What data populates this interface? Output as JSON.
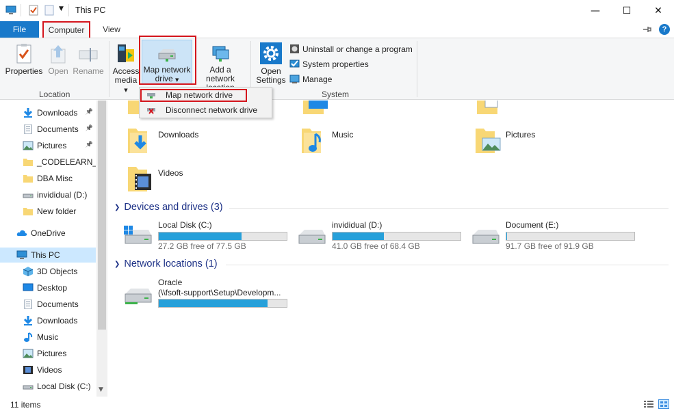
{
  "window": {
    "title": "This PC",
    "minimize": "—",
    "maximize": "☐",
    "close": "✕"
  },
  "ribbon_tabs": {
    "file": "File",
    "computer": "Computer",
    "view": "View"
  },
  "ribbon": {
    "location": {
      "label": "Location",
      "properties": "Properties",
      "open": "Open",
      "rename": "Rename"
    },
    "network": {
      "access_media_1": "Access",
      "access_media_2": "media",
      "map_drive_1": "Map network",
      "map_drive_2": "drive",
      "add_location_1": "Add a network",
      "add_location_2": "location"
    },
    "system": {
      "label": "System",
      "open_settings_1": "Open",
      "open_settings_2": "Settings",
      "uninstall": "Uninstall or change a program",
      "system_properties": "System properties",
      "manage": "Manage"
    }
  },
  "dropdown": {
    "map_network_drive": "Map network drive",
    "disconnect_network_drive": "Disconnect network drive"
  },
  "nav": {
    "items": [
      {
        "label": "Downloads",
        "icon": "download-icon",
        "pinned": true
      },
      {
        "label": "Documents",
        "icon": "document-icon",
        "pinned": true
      },
      {
        "label": "Pictures",
        "icon": "picture-icon",
        "pinned": true
      },
      {
        "label": "_CODELEARN_-_",
        "icon": "folder-icon",
        "pinned": false
      },
      {
        "label": "DBA Misc",
        "icon": "folder-icon",
        "pinned": false
      },
      {
        "label": "invididual (D:)",
        "icon": "drive-icon",
        "pinned": false
      },
      {
        "label": "New folder",
        "icon": "folder-icon",
        "pinned": false
      },
      {
        "label": "OneDrive",
        "icon": "cloud-icon",
        "pinned": false
      },
      {
        "label": "This PC",
        "icon": "computer-icon",
        "pinned": false
      },
      {
        "label": "3D Objects",
        "icon": "cube-icon",
        "pinned": false
      },
      {
        "label": "Desktop",
        "icon": "desktop-icon",
        "pinned": false
      },
      {
        "label": "Documents",
        "icon": "document-icon",
        "pinned": false
      },
      {
        "label": "Downloads",
        "icon": "download-icon",
        "pinned": false
      },
      {
        "label": "Music",
        "icon": "music-icon",
        "pinned": false
      },
      {
        "label": "Pictures",
        "icon": "picture-icon",
        "pinned": false
      },
      {
        "label": "Videos",
        "icon": "video-icon",
        "pinned": false
      },
      {
        "label": "Local Disk (C:)",
        "icon": "drive-icon",
        "pinned": false
      }
    ]
  },
  "folders": {
    "downloads": "Downloads",
    "music": "Music",
    "pictures": "Pictures",
    "videos": "Videos"
  },
  "sections": {
    "devices": "Devices and drives (3)",
    "network": "Network locations (1)"
  },
  "drives": [
    {
      "name": "Local Disk (C:)",
      "free": "27.2 GB free of 77.5 GB",
      "used_fraction": 0.649
    },
    {
      "name": "invididual (D:)",
      "free": "41.0 GB free of 68.4 GB",
      "used_fraction": 0.401
    },
    {
      "name": "Document (E:)",
      "free": "91.7 GB free of 91.9 GB",
      "used_fraction": 0.002
    }
  ],
  "network_locations": [
    {
      "name": "Oracle",
      "path": "(\\\\fsoft-support\\Setup\\Developm...",
      "used_fraction": 0.85
    }
  ],
  "status": {
    "items": "11 items"
  },
  "colors": {
    "accent": "#1979ca",
    "highlight_red": "#d4141c",
    "bar_fill": "#26a0da",
    "section_header": "#1e3287",
    "selection": "#cce8ff"
  }
}
